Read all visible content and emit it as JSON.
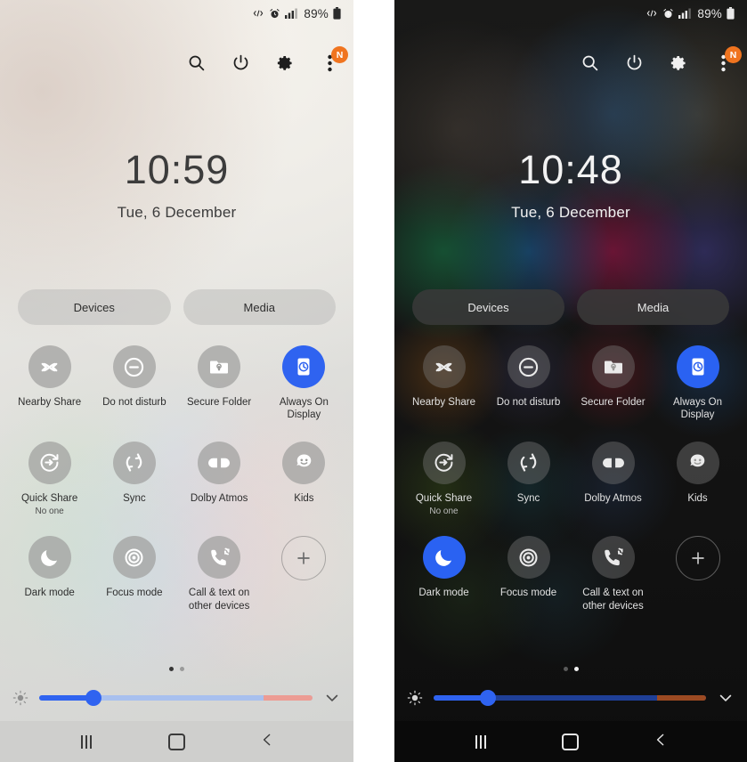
{
  "panels": [
    {
      "theme": "light",
      "status_bar": {
        "icons": [
          "nearby-share-status-icon",
          "alarm-icon",
          "signal-bars-icon"
        ],
        "battery_percent": "89%"
      },
      "header": {
        "search_label": "search-icon",
        "power_label": "power-icon",
        "settings_label": "gear-icon",
        "more_label": "more-options-icon",
        "badge": "N"
      },
      "clock": {
        "time": "10:59",
        "date": "Tue, 6 December"
      },
      "pills": [
        {
          "label": "Devices"
        },
        {
          "label": "Media"
        }
      ],
      "toggles": [
        [
          {
            "label": "Nearby Share",
            "sub": "",
            "icon": "nearby-share-icon",
            "active": false
          },
          {
            "label": "Do not disturb",
            "sub": "",
            "icon": "do-not-disturb-icon",
            "active": false
          },
          {
            "label": "Secure Folder",
            "sub": "",
            "icon": "secure-folder-icon",
            "active": false
          },
          {
            "label": "Always On Display",
            "sub": "",
            "icon": "always-on-display-icon",
            "active": true
          }
        ],
        [
          {
            "label": "Quick Share",
            "sub": "No one",
            "icon": "quick-share-icon",
            "active": false
          },
          {
            "label": "Sync",
            "sub": "",
            "icon": "sync-icon",
            "active": false
          },
          {
            "label": "Dolby Atmos",
            "sub": "",
            "icon": "dolby-atmos-icon",
            "active": false
          },
          {
            "label": "Kids",
            "sub": "",
            "icon": "kids-icon",
            "active": false
          }
        ],
        [
          {
            "label": "Dark mode",
            "sub": "",
            "icon": "moon-icon",
            "active": false
          },
          {
            "label": "Focus mode",
            "sub": "",
            "icon": "focus-mode-icon",
            "active": false
          },
          {
            "label": "Call & text on other devices",
            "sub": "",
            "icon": "call-text-other-devices-icon",
            "active": false
          },
          {
            "label": "",
            "sub": "",
            "icon": "add-button-icon",
            "active": false,
            "is_add": true
          }
        ]
      ],
      "pager": {
        "count": 2,
        "active_index": 0
      },
      "brightness": {
        "icon": "brightness-icon",
        "value_percent": 20,
        "tail_start_percent": 82,
        "expand_icon": "chevron-down-icon"
      },
      "navbar": {
        "recents_label": "recents-button",
        "home_label": "home-button",
        "back_label": "back-button"
      }
    },
    {
      "theme": "dark",
      "status_bar": {
        "icons": [
          "nearby-share-status-icon",
          "alarm-icon",
          "signal-bars-icon"
        ],
        "battery_percent": "89%"
      },
      "header": {
        "search_label": "search-icon",
        "power_label": "power-icon",
        "settings_label": "gear-icon",
        "more_label": "more-options-icon",
        "badge": "N"
      },
      "clock": {
        "time": "10:48",
        "date": "Tue, 6 December"
      },
      "pills": [
        {
          "label": "Devices"
        },
        {
          "label": "Media"
        }
      ],
      "toggles": [
        [
          {
            "label": "Nearby Share",
            "sub": "",
            "icon": "nearby-share-icon",
            "active": false
          },
          {
            "label": "Do not disturb",
            "sub": "",
            "icon": "do-not-disturb-icon",
            "active": false
          },
          {
            "label": "Secure Folder",
            "sub": "",
            "icon": "secure-folder-icon",
            "active": false
          },
          {
            "label": "Always On Display",
            "sub": "",
            "icon": "always-on-display-icon",
            "active": true
          }
        ],
        [
          {
            "label": "Quick Share",
            "sub": "No one",
            "icon": "quick-share-icon",
            "active": false
          },
          {
            "label": "Sync",
            "sub": "",
            "icon": "sync-icon",
            "active": false
          },
          {
            "label": "Dolby Atmos",
            "sub": "",
            "icon": "dolby-atmos-icon",
            "active": false
          },
          {
            "label": "Kids",
            "sub": "",
            "icon": "kids-icon",
            "active": false
          }
        ],
        [
          {
            "label": "Dark mode",
            "sub": "",
            "icon": "moon-icon",
            "active": true
          },
          {
            "label": "Focus mode",
            "sub": "",
            "icon": "focus-mode-icon",
            "active": false
          },
          {
            "label": "Call & text on other devices",
            "sub": "",
            "icon": "call-text-other-devices-icon",
            "active": false
          },
          {
            "label": "",
            "sub": "",
            "icon": "add-button-icon",
            "active": false,
            "is_add": true
          }
        ]
      ],
      "pager": {
        "count": 2,
        "active_index": 1
      },
      "brightness": {
        "icon": "brightness-icon",
        "value_percent": 20,
        "tail_start_percent": 82,
        "expand_icon": "chevron-down-icon"
      },
      "navbar": {
        "recents_label": "recents-button",
        "home_label": "home-button",
        "back_label": "back-button"
      }
    }
  ],
  "colors": {
    "accent_blue": "#2f63f0",
    "badge_orange": "#f0741f",
    "slider_tail_light": "#ec9c94",
    "slider_tail_dark": "#9c4a22"
  }
}
